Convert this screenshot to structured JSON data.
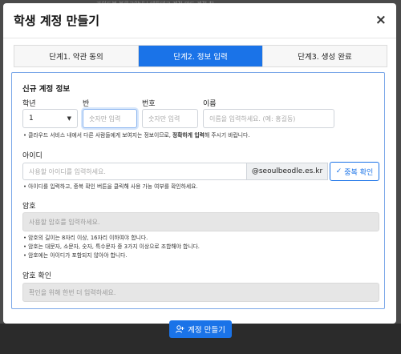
{
  "modal": {
    "title": "학생 계정 만들기",
    "close_icon": "×"
  },
  "steps": [
    {
      "label": "단계1. 약관 동의",
      "active": false
    },
    {
      "label": "단계2. 정보 입력",
      "active": true
    },
    {
      "label": "단계3. 생성 완료",
      "active": false
    }
  ],
  "new_account": {
    "section_title": "신규 계정 정보",
    "grade": {
      "label": "학년",
      "value": "1"
    },
    "class": {
      "label": "반",
      "placeholder": "숫자만 입력"
    },
    "number": {
      "label": "번호",
      "placeholder": "숫자만 입력"
    },
    "name": {
      "label": "이름",
      "placeholder": "이름을 입력하세요. (예: 홍길동)"
    },
    "hint_prefix": "클라우드 서비스 내에서 다른 사람들에게 보여지는 정보이므로, ",
    "hint_bold": "정확하게 입력",
    "hint_suffix": "해 주시기 바랍니다."
  },
  "id_section": {
    "label": "아이디",
    "placeholder": "사용할 아이디를 입력하세요.",
    "domain": "@seoulbeodle.es.kr",
    "check_button": "중복 확인",
    "check_icon": "✓",
    "hint": "아이디를 입력하고, 중복 확인 버튼을 클릭해 사용 가능 여부를 확인하세요."
  },
  "password": {
    "label": "암호",
    "placeholder": "사용할 암호를 입력하세요.",
    "rules": [
      "암호의 길이는 8자리 이상, 16자리 이하여야 합니다.",
      "암호는 대문자, 소문자, 숫자, 특수문자 중 3가지 이상으로 조합해야 합니다.",
      "암호에는 아이디가 포함되지 않아야 합니다."
    ]
  },
  "password_confirm": {
    "label": "암호 확인",
    "placeholder": "확인을 위해 한번 더 입력하세요."
  },
  "footer": {
    "create_button": "계정 만들기",
    "create_icon": "add-user-icon"
  },
  "background": {
    "text": "가이드북 블로그안내 | 에듀테크     계정 만드       계정 찾"
  },
  "colors": {
    "accent": "#1a73e8",
    "disabled_bg": "#e6e6e6"
  }
}
